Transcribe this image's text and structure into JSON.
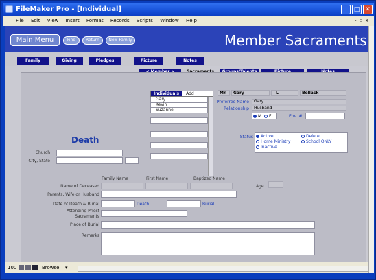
{
  "window": {
    "title": "FileMaker Pro - [Individual]"
  },
  "menu": {
    "items": [
      "File",
      "Edit",
      "View",
      "Insert",
      "Format",
      "Records",
      "Scripts",
      "Window",
      "Help"
    ]
  },
  "header": {
    "main_menu": "Main Menu",
    "find": "Find",
    "return": "Return",
    "new_family": "New Family",
    "title": "Member Sacraments"
  },
  "nav": {
    "tabs": [
      "Family",
      "Giving",
      "Pledges",
      "Picture",
      "Notes"
    ]
  },
  "subnav": {
    "member": "< Member >",
    "sacraments": "Sacraments",
    "groups": "Groups/Talents",
    "picture": "Picture",
    "notes": "Notes"
  },
  "individuals": {
    "header": "Individuals",
    "add": "Add",
    "names": [
      "Gary",
      "Kevin",
      "Suzanne"
    ]
  },
  "person": {
    "prefix": "Mr.",
    "first": "Gary",
    "middle": "L",
    "last": "Bellack",
    "preferred_label": "Preferred Name",
    "preferred": "Gary",
    "relationship_label": "Relationship",
    "relationship": "Husband",
    "sex_m": "M",
    "sex_f": "F",
    "env_label": "Env. #"
  },
  "status": {
    "label": "Status",
    "active": "Active",
    "delete": "Delete",
    "home": "Home Ministry",
    "school": "School ONLY",
    "inactive": "Inactive"
  },
  "death": {
    "title": "Death",
    "church": "Church",
    "city_state": "City, State"
  },
  "table": {
    "family_name": "Family Name",
    "first_name": "First Name",
    "baptized_name": "Baptized Name",
    "name_of_deceased": "Name of Deceased",
    "age": "Age",
    "parents": "Parents, Wife or Husband",
    "date_label": "Date of Death & Burial",
    "death_short": "Death",
    "burial": "Burial",
    "attending": "Attending Priest",
    "sacraments": "Sacraments",
    "place": "Place of Burial",
    "remarks": "Remarks"
  },
  "statusbar": {
    "zoom": "100",
    "mode": "Browse"
  }
}
